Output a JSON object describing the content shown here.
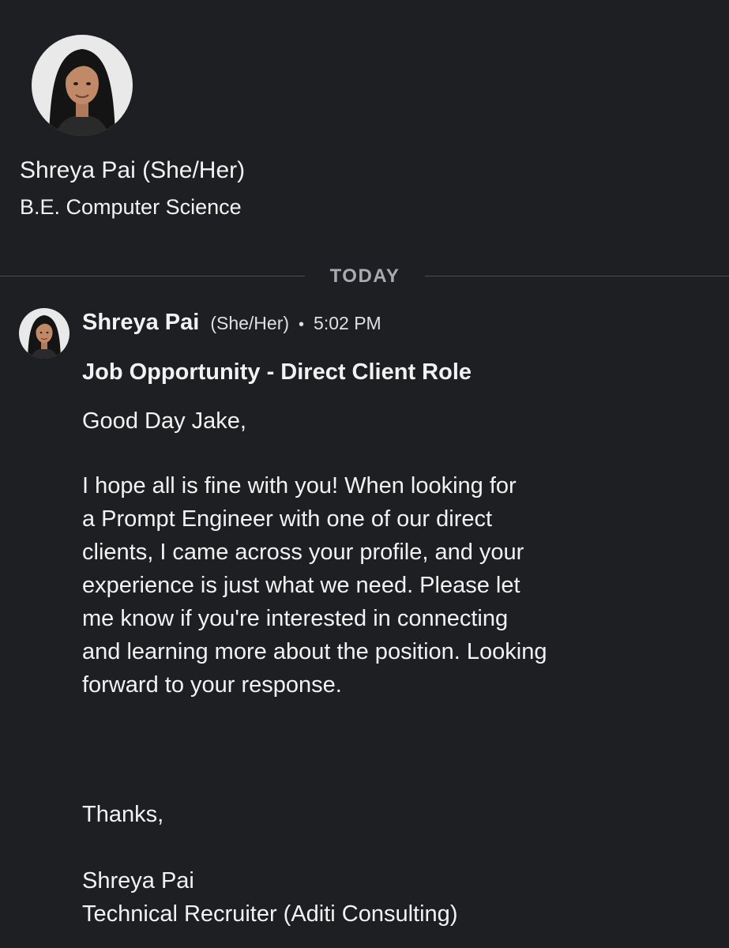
{
  "profile": {
    "name": "Shreya Pai (She/Her)",
    "headline": "B.E. Computer Science"
  },
  "divider": {
    "label": "TODAY"
  },
  "message": {
    "sender": "Shreya Pai",
    "pronouns": "(She/Her)",
    "separator": "•",
    "time": "5:02 PM",
    "subject": "Job Opportunity - Direct Client Role",
    "greeting": "Good Day Jake,",
    "body_lines": [
      "I hope all is fine with you! When looking for",
      "a Prompt Engineer with one of our direct",
      "clients, I came across your profile, and your",
      "experience is just what we need. Please let",
      "me know if you're interested in connecting",
      "and learning more about the position. Looking",
      "forward to your response."
    ],
    "signoff": "Thanks,",
    "signature_name": "Shreya Pai",
    "signature_title": "Technical Recruiter (Aditi Consulting)"
  },
  "icons": {
    "profile_avatar": "person-avatar-icon",
    "sender_avatar": "person-avatar-icon"
  },
  "colors": {
    "background": "#1d1f23",
    "text": "#f2f2f2",
    "muted": "#a9abb0",
    "divider": "#4b4e55"
  }
}
